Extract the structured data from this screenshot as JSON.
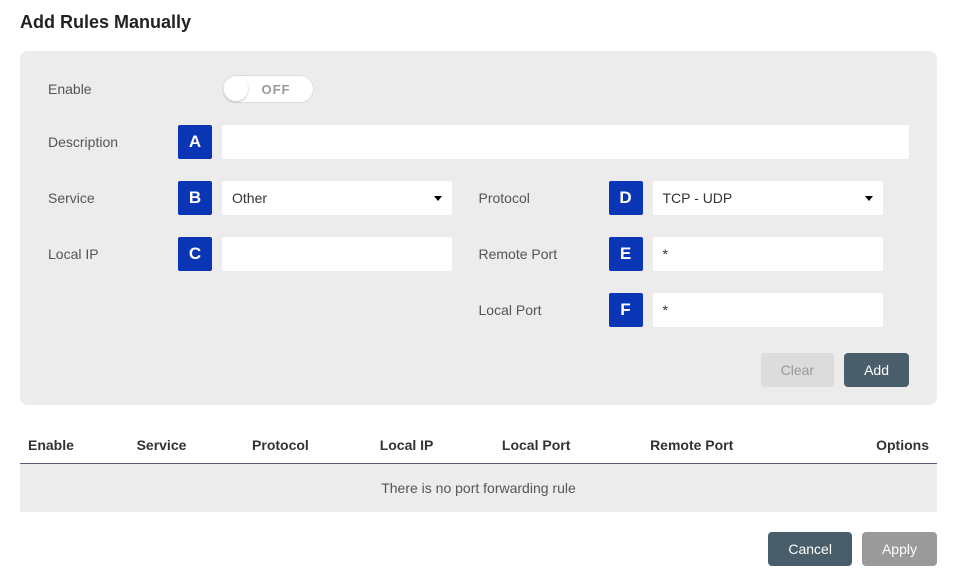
{
  "title": "Add Rules Manually",
  "form": {
    "enable": {
      "label": "Enable",
      "toggle_text": "OFF"
    },
    "description": {
      "label": "Description",
      "badge": "A",
      "value": ""
    },
    "service": {
      "label": "Service",
      "badge": "B",
      "value": "Other"
    },
    "protocol": {
      "label": "Protocol",
      "badge": "D",
      "value": "TCP - UDP"
    },
    "local_ip": {
      "label": "Local IP",
      "badge": "C",
      "value": ""
    },
    "remote_port": {
      "label": "Remote Port",
      "badge": "E",
      "value": "*"
    },
    "local_port": {
      "label": "Local Port",
      "badge": "F",
      "value": "*"
    }
  },
  "buttons": {
    "clear": "Clear",
    "add": "Add",
    "cancel": "Cancel",
    "apply": "Apply"
  },
  "table": {
    "headers": [
      "Enable",
      "Service",
      "Protocol",
      "Local IP",
      "Local Port",
      "Remote Port",
      "Options"
    ],
    "empty_text": "There is no port forwarding rule"
  }
}
